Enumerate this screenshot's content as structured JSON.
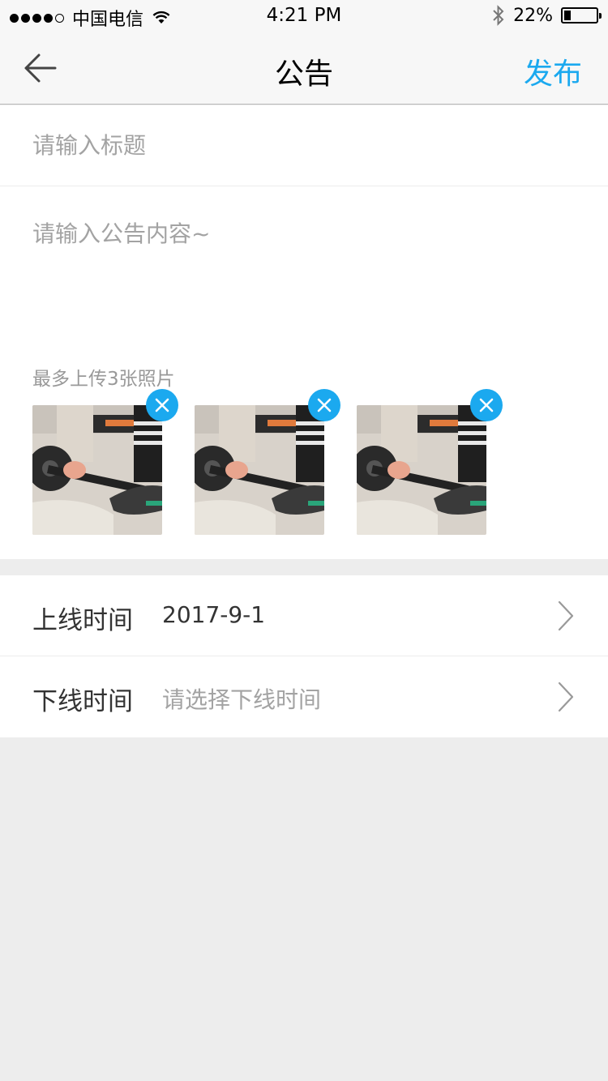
{
  "status_bar": {
    "carrier": "中国电信",
    "time": "4:21 PM",
    "battery": "22%",
    "battery_level": 0.22,
    "signal_strength": 4
  },
  "nav": {
    "title": "公告",
    "publish": "发布"
  },
  "form": {
    "title_placeholder": "请输入标题",
    "content_placeholder": "请输入公告内容~",
    "upload_hint": "最多上传3张照片",
    "photos": [
      {
        "name": "photo-1"
      },
      {
        "name": "photo-2"
      },
      {
        "name": "photo-3"
      }
    ]
  },
  "schedule": {
    "online_label": "上线时间",
    "online_value": "2017-9-1",
    "offline_label": "下线时间",
    "offline_placeholder": "请选择下线时间"
  },
  "colors": {
    "accent": "#1ba9ef",
    "background": "#ededed",
    "placeholder": "#a3a3a3"
  }
}
